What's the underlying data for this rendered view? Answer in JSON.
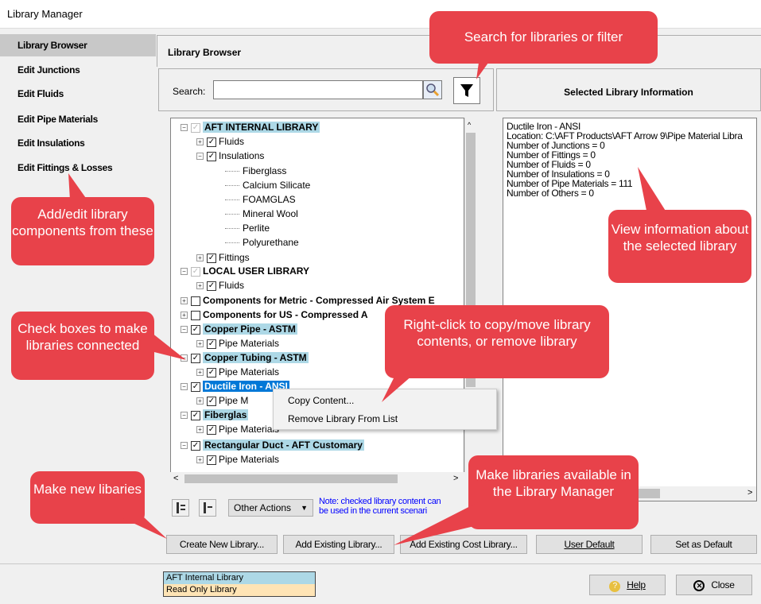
{
  "window": {
    "title": "Library Manager"
  },
  "nav": {
    "items": [
      {
        "label": "Library Browser",
        "selected": true
      },
      {
        "label": "Edit Junctions"
      },
      {
        "label": "Edit Fluids"
      },
      {
        "label": "Edit Pipe Materials"
      },
      {
        "label": "Edit Insulations"
      },
      {
        "label": "Edit Fittings & Losses"
      }
    ]
  },
  "main": {
    "heading": "Library Browser"
  },
  "search": {
    "label": "Search:",
    "value": ""
  },
  "info": {
    "heading": "Selected Library Information",
    "lines": [
      "Ductile Iron - ANSI",
      "Location: C:\\AFT Products\\AFT Arrow 9\\Pipe Material Libra",
      "Number of Junctions = 0",
      "Number of Fittings = 0",
      "Number of Fluids = 0",
      "Number of Insulations = 0",
      "Number of Pipe Materials = 111",
      "Number of Others = 0"
    ]
  },
  "tree": {
    "rows": [
      "AFT INTERNAL LIBRARY",
      "Fluids",
      "Insulations",
      "Fiberglass",
      "Calcium Silicate",
      "FOAMGLAS",
      "Mineral Wool",
      "Perlite",
      "Polyurethane",
      "Fittings",
      "LOCAL USER LIBRARY",
      "Fluids",
      "Components for Metric - Compressed Air System E",
      "Components for US - Compressed A",
      "Copper Pipe - ASTM",
      "Pipe Materials",
      "Copper Tubing - ASTM",
      "Pipe Materials",
      "Ductile Iron - ANSI",
      "Pipe M",
      "Fiberglas",
      "Pipe Materials",
      "Rectangular Duct - AFT Customary",
      "Pipe Materials"
    ]
  },
  "context_menu": {
    "items": [
      "Copy Content...",
      "Remove Library From List"
    ]
  },
  "toolbar": {
    "other_actions": "Other Actions",
    "note_line1": "Note: checked library content can",
    "note_line2": "be used in the current scenari"
  },
  "buttons": {
    "create": "Create New Library...",
    "add_existing": "Add Existing Library...",
    "add_cost": "Add Existing Cost Library...",
    "user_default": "User Default",
    "set_default": "Set as Default",
    "help": "Help",
    "close": "Close"
  },
  "legend": {
    "internal": "AFT Internal Library",
    "readonly": "Read Only Library"
  },
  "callouts": {
    "search": "Search for libraries or filter",
    "add_edit": "Add/edit library components from these",
    "view_info": "View information about the selected library",
    "check_boxes": "Check boxes to make libraries connected",
    "right_click": "Right-click to copy/move library contents, or remove library",
    "make_new": "Make new libaries",
    "make_available": "Make libraries available in the Library Manager"
  },
  "colors": {
    "callout": "#e8424a",
    "highlight_cyan": "#add8e6",
    "highlight_selected": "#0078d7",
    "note_blue": "#0000ff"
  }
}
